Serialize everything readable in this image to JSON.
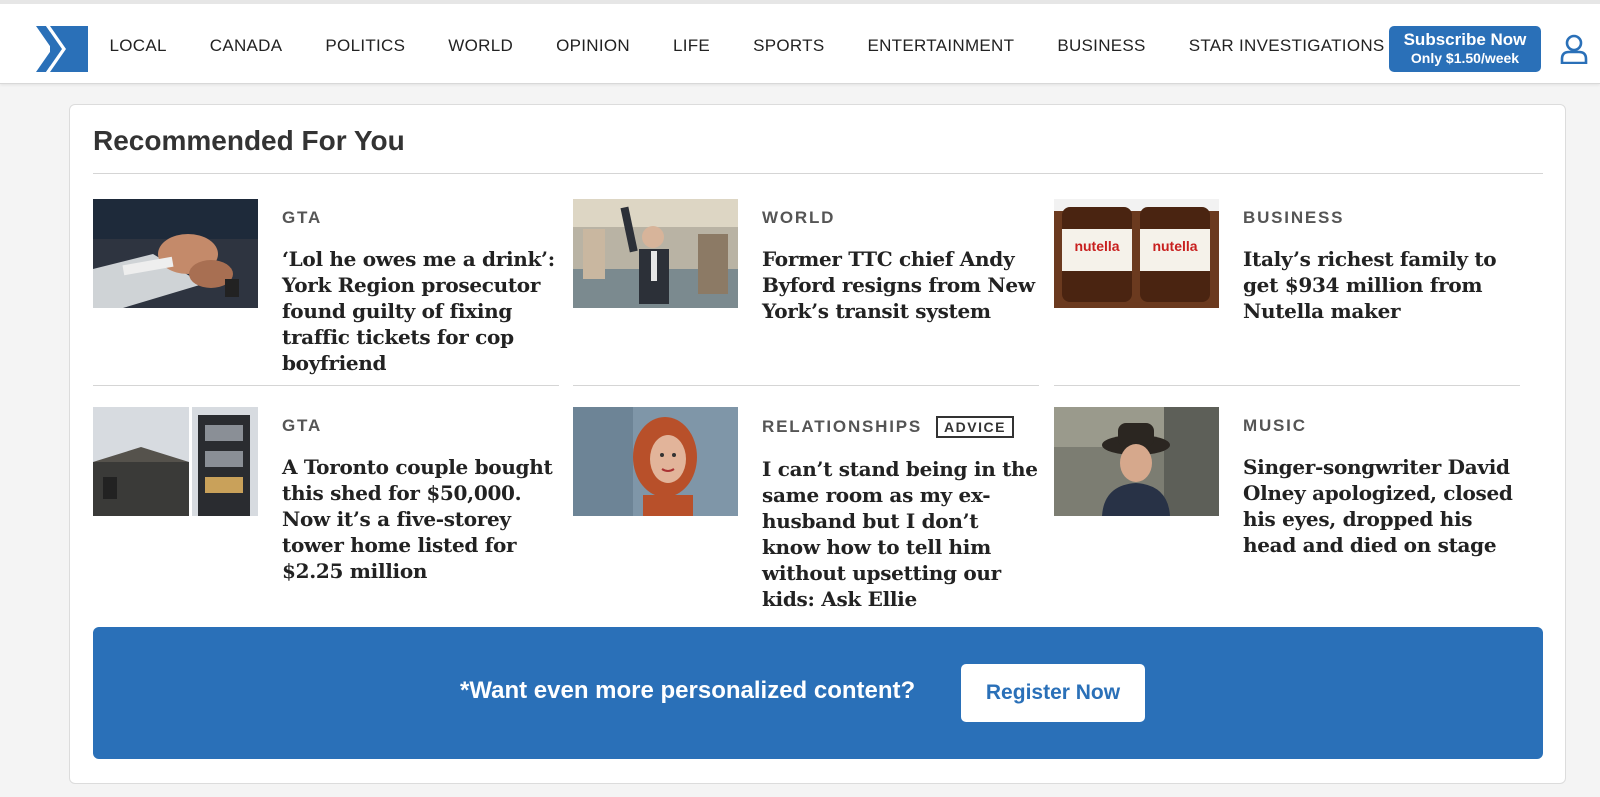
{
  "nav": {
    "logo_icon": "toronto-star-logo",
    "items": [
      "LOCAL",
      "CANADA",
      "POLITICS",
      "WORLD",
      "OPINION",
      "LIFE",
      "SPORTS",
      "ENTERTAINMENT",
      "BUSINESS",
      "STAR INVESTIGATIONS"
    ],
    "subscribe_line1": "Subscribe Now",
    "subscribe_line2": "Only $1.50/week",
    "user_icon": "user-icon"
  },
  "recommended": {
    "title": "Recommended For You",
    "stories": [
      {
        "category": "GTA",
        "badge": "",
        "headline": "‘Lol he owes me a drink’: York Region prosecutor found guilty of fixing traffic tickets for cop boyfriend",
        "image": "hands-writing-ticket"
      },
      {
        "category": "WORLD",
        "badge": "",
        "headline": "Former TTC chief Andy Byford resigns from New York’s transit system",
        "image": "man-on-subway"
      },
      {
        "category": "BUSINESS",
        "badge": "",
        "headline": "Italy’s richest family to get $934 million from Nutella maker",
        "image": "nutella-jars",
        "image_text": "nutella"
      },
      {
        "category": "GTA",
        "badge": "",
        "headline": "A Toronto couple bought this shed for $50,000. Now it’s a five-storey tower home listed for $2.25 million",
        "image": "shed-and-tower"
      },
      {
        "category": "RELATIONSHIPS",
        "badge": "ADVICE",
        "headline": "I can’t stand being in the same room as my ex-husband but I don’t know how to tell him without upsetting our kids: Ask Ellie",
        "image": "red-haired-woman-portrait"
      },
      {
        "category": "MUSIC",
        "badge": "",
        "headline": "Singer-songwriter David Olney apologized, closed his eyes, dropped his head and died on stage",
        "image": "man-in-hat-portrait"
      }
    ]
  },
  "cta": {
    "text": "*Want even more personalized content?",
    "button": "Register Now"
  },
  "colors": {
    "brand_blue": "#2a70b8",
    "page_bg": "#f4f4f4"
  }
}
